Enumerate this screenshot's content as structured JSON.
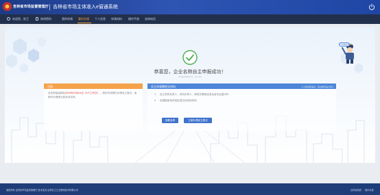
{
  "header": {
    "org_name": "吉林省市场监督管理厅",
    "system_name": "吉林省市场主体准入e窗通系统"
  },
  "nav": {
    "user": "欢迎您，姓王",
    "change_password": "修改密码",
    "items": [
      {
        "label": "我的申请",
        "active": false
      },
      {
        "label": "委托办理",
        "active": true
      },
      {
        "label": "个人信息",
        "active": false
      },
      {
        "label": "申请材料",
        "active": false
      },
      {
        "label": "操作手册",
        "active": false
      },
      {
        "label": "咨询电话",
        "active": false
      }
    ]
  },
  "result": {
    "title": "恭喜您，企业名称自主申报成功！",
    "subtitle": "Congratulations，you are"
  },
  "notice": {
    "title": "注意",
    "text_1": "该名称保留期至",
    "date": "2020年03月04日（5个工作日）",
    "text_2": "，请在有效期内办理设立登记，逾期不办理视为放弃该名称。"
  },
  "next_steps": {
    "title": "设立申请需提交材料",
    "hint": "以下材料需准备好，可在线申请设立登记",
    "items": [
      {
        "num": "1",
        "text": "设立机构负责人、财务负责人、联络员基础信息及身份证复印件"
      },
      {
        "num": "2",
        "text": "依据国家相关规定提交的其他材料"
      }
    ]
  },
  "buttons": {
    "secondary": "查看名称",
    "primary": "立即办理设立登记"
  },
  "assistant": {
    "bubble": "有问题找我"
  },
  "footer": {
    "copyright": "版权所有 吉林省市场监督管理厅  技术支持 吉林省之江互联网技术有限公司",
    "link_1": "吉林省政府",
    "link_2": "操作手册"
  },
  "colors": {
    "header": "#2f55b4",
    "nav": "#23304d",
    "active": "#f5a030",
    "notice_header": "#f5a34b",
    "steps_header": "#4d86d8",
    "button": "#3f73cc",
    "success": "#4caf50"
  }
}
